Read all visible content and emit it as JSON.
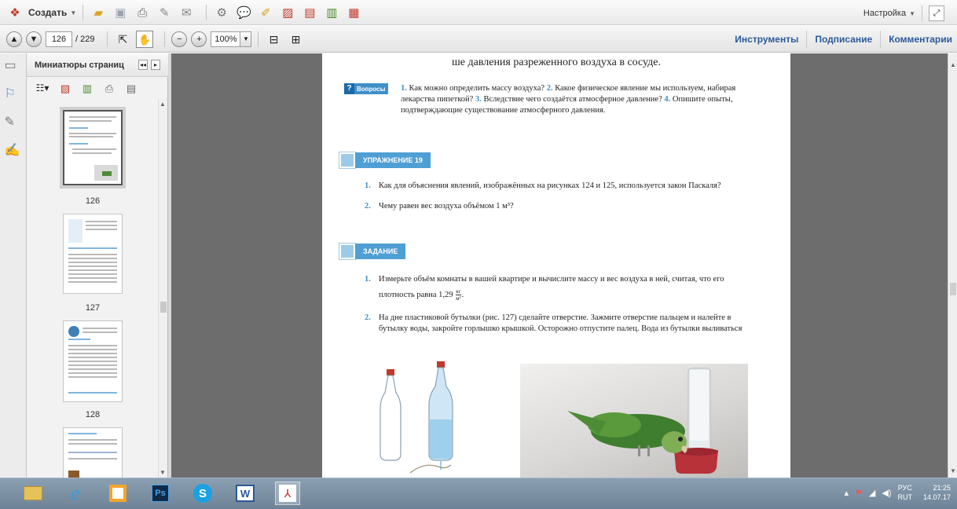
{
  "toolbar1": {
    "create_label": "Создать",
    "settings_label": "Настройка"
  },
  "toolbar2": {
    "current_page": "126",
    "total_pages": "/ 229",
    "zoom": "100%",
    "tools_link": "Инструменты",
    "sign_link": "Подписание",
    "comments_link": "Комментарии"
  },
  "thumbnails": {
    "title": "Миниатюры страниц",
    "pages": [
      {
        "label": "126",
        "selected": true
      },
      {
        "label": "127",
        "selected": false
      },
      {
        "label": "128",
        "selected": false
      }
    ]
  },
  "document": {
    "top_line": "ше давления разреженного воздуха в сосуде.",
    "questions_badge": "Вопросы",
    "questions": [
      {
        "n": "1.",
        "text": "Как можно определить массу воздуха?"
      },
      {
        "n": "2.",
        "text": "Какое физическое явление мы используем, набирая лекарства пипеткой?"
      },
      {
        "n": "3.",
        "text": "Вследствие чего создаётся атмосферное давление?"
      },
      {
        "n": "4.",
        "text": "Опишите опыты, подтверждающие существование атмосферного давления."
      }
    ],
    "exercise_title": "УПРАЖНЕНИЕ 19",
    "exercise_items": [
      {
        "n": "1.",
        "text": "Как для объяснения явлений, изображённых на рисунках 124 и 125, используется закон Паскаля?"
      },
      {
        "n": "2.",
        "text": "Чему равен вес воздуха объёмом 1 м³?"
      }
    ],
    "task_title": "ЗАДАНИЕ",
    "task_items": [
      {
        "n": "1.",
        "text": "Измерьте объём комнаты в вашей квартире и вычислите массу и вес воздуха в ней, считая, что его плотность равна 1,29",
        "frac_top": "кг",
        "frac_bottom": "м³",
        "tail": "."
      },
      {
        "n": "2.",
        "text": "На дне пластиковой бутылки (рис. 127) сделайте отверстие. Зажмите отверстие пальцем и налейте в бутылку воды, закройте горлышко крышкой. Осторожно отпустите палец. Вода из бутылки выливаться"
      }
    ]
  },
  "taskbar": {
    "lang_top": "РУС",
    "lang_bottom": "RUT",
    "time": "21:25",
    "date": "14.07.17"
  }
}
